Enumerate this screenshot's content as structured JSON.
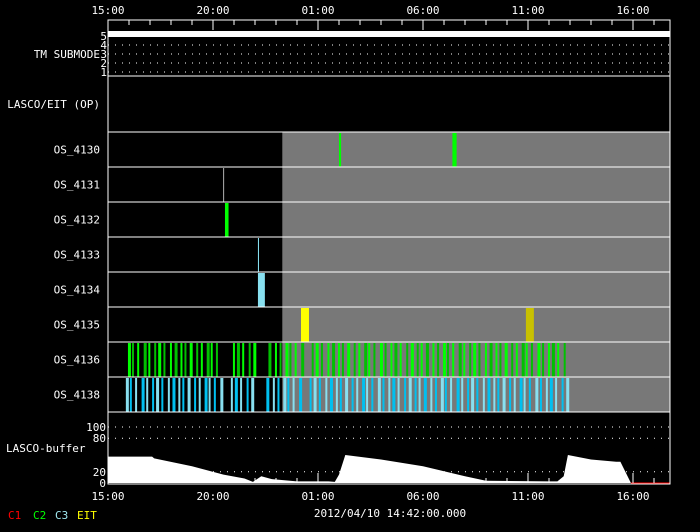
{
  "chart_data": {
    "type": "timeline",
    "title": "LASCO/EIT operations timeline",
    "timestamp": "2012/04/10 14:42:00.000",
    "x_unit": "hours since 15:00",
    "xlim": [
      0,
      26.8
    ],
    "x_ticks": [
      "15:00",
      "20:00",
      "01:00",
      "06:00",
      "11:00",
      "16:00"
    ],
    "x_tick_hours": [
      0,
      5,
      10,
      15,
      20,
      25
    ],
    "future_start_hour": 8.3,
    "rows": [
      {
        "label": "TM SUBMODE",
        "y_ticks": [
          "5",
          "4",
          "3",
          "2",
          "1"
        ],
        "value": 5
      },
      {
        "label": "LASCO/EIT (OP)"
      },
      {
        "label": "OS_4130",
        "events": [
          {
            "t": 11.0,
            "w": 0.1,
            "color": "#00ff00"
          },
          {
            "t": 16.4,
            "w": 0.2,
            "color": "#00ff00"
          }
        ]
      },
      {
        "label": "OS_4131",
        "events": [
          {
            "t": 5.48,
            "w": 0.05,
            "color": "#aaaaaa"
          }
        ]
      },
      {
        "label": "OS_4132",
        "events": [
          {
            "t": 5.57,
            "w": 0.17,
            "color": "#00ff00"
          }
        ]
      },
      {
        "label": "OS_4133",
        "events": [
          {
            "t": 7.14,
            "w": 0.05,
            "color": "#88e0f0"
          }
        ]
      },
      {
        "label": "OS_4134",
        "events": [
          {
            "t": 7.14,
            "w": 0.33,
            "color": "#88e0f0"
          }
        ]
      },
      {
        "label": "OS_4135",
        "events": [
          {
            "t": 9.19,
            "w": 0.38,
            "color": "#ffff00"
          },
          {
            "t": 19.9,
            "w": 0.38,
            "color": "#c8c000"
          }
        ]
      },
      {
        "label": "OS_4136",
        "pattern": "dense",
        "start": 0.95,
        "end": 21.85,
        "gaps": [
          [
            5.4,
            5.7
          ],
          [
            7.05,
            7.5
          ],
          [
            9.3,
            9.6
          ]
        ],
        "colors": [
          "#00ff00",
          "#00c000"
        ]
      },
      {
        "label": "OS_4138",
        "pattern": "dense",
        "start": 0.85,
        "end": 21.85,
        "gaps": [
          [
            5.4,
            5.7
          ],
          [
            7.05,
            7.5
          ],
          [
            9.3,
            9.6
          ]
        ],
        "colors": [
          "#88e0f0",
          "#00c0f0"
        ]
      }
    ],
    "buffer": {
      "label": "LASCO-buffer",
      "y_ticks": [
        "100",
        "80",
        "20",
        "0"
      ],
      "y_tick_values": [
        100,
        80,
        20,
        0
      ],
      "ylim": [
        0,
        115
      ],
      "points": [
        [
          0,
          47
        ],
        [
          2.1,
          47
        ],
        [
          2.2,
          44
        ],
        [
          4,
          30
        ],
        [
          5.5,
          15
        ],
        [
          6.5,
          8
        ],
        [
          6.9,
          2
        ],
        [
          7.3,
          12
        ],
        [
          7.8,
          7
        ],
        [
          9,
          3
        ],
        [
          10,
          3
        ],
        [
          10.5,
          3
        ],
        [
          10.8,
          2
        ],
        [
          11.0,
          15
        ],
        [
          11.3,
          50
        ],
        [
          13,
          42
        ],
        [
          15,
          30
        ],
        [
          17,
          12
        ],
        [
          18,
          4
        ],
        [
          21,
          3
        ],
        [
          21.4,
          3
        ],
        [
          21.7,
          12
        ],
        [
          21.9,
          50
        ],
        [
          23,
          42
        ],
        [
          24.2,
          38
        ],
        [
          24.4,
          38
        ],
        [
          24.9,
          0
        ]
      ],
      "future_line_color": "#ff0000"
    },
    "legend": [
      {
        "label": "C1",
        "color": "#ff0000"
      },
      {
        "label": "C2",
        "color": "#00ff00"
      },
      {
        "label": "C3",
        "color": "#a0e8f0"
      },
      {
        "label": "EIT",
        "color": "#ffff00"
      }
    ]
  }
}
